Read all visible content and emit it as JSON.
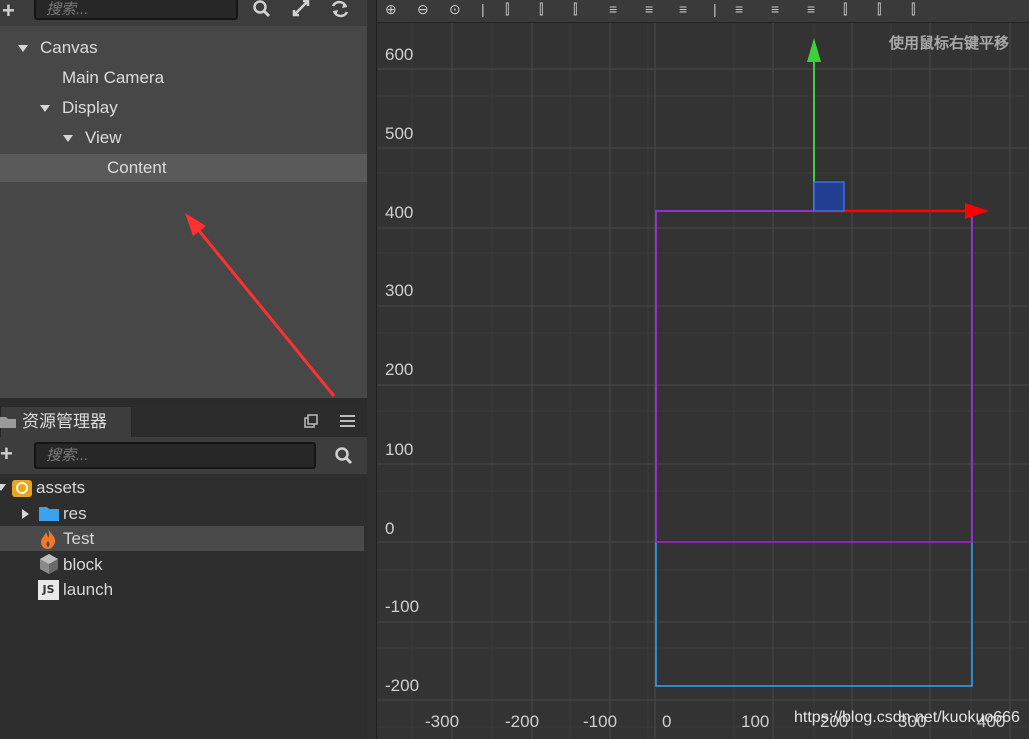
{
  "hierarchy": {
    "search_placeholder": "搜索...",
    "nodes": [
      {
        "label": "Canvas",
        "expanded": true
      },
      {
        "label": "Main Camera"
      },
      {
        "label": "Display",
        "expanded": true
      },
      {
        "label": "View",
        "expanded": true
      },
      {
        "label": "Content",
        "selected": true
      }
    ]
  },
  "assets_panel": {
    "tab_label": "资源管理器",
    "search_placeholder": "搜索...",
    "items": [
      {
        "label": "assets",
        "icon": "assets-db-icon"
      },
      {
        "label": "res",
        "icon": "folder-icon"
      },
      {
        "label": "Test",
        "icon": "fire-scene-icon",
        "selected": true
      },
      {
        "label": "block",
        "icon": "prefab-cube-icon"
      },
      {
        "label": "launch",
        "icon": "js-script-icon"
      }
    ]
  },
  "scene": {
    "hint": "使用鼠标右键平移",
    "y_ticks": [
      "600",
      "500",
      "400",
      "300",
      "200",
      "100",
      "0",
      "-100",
      "-200"
    ],
    "x_ticks": [
      "-300",
      "-200",
      "-100",
      "0",
      "100",
      "200",
      "300",
      "400"
    ],
    "colors": {
      "x_axis": "#ff0000",
      "y_axis": "#3ecf3e",
      "content_rect": "#2aa6ff",
      "canvas_rect": "#b01ee0"
    }
  },
  "watermark": "https://blog.csdn.net/kuokuo666"
}
